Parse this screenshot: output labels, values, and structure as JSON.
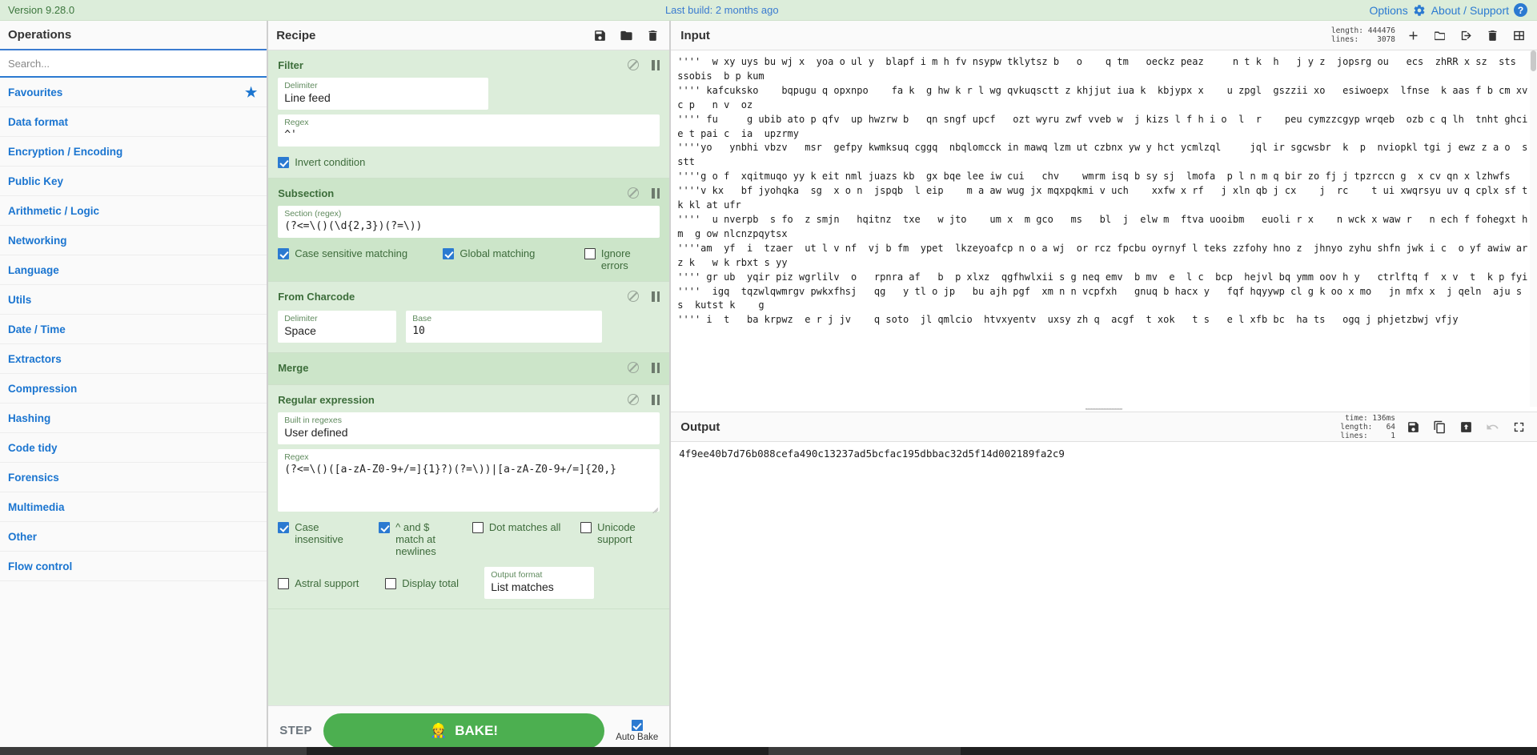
{
  "banner": {
    "version": "Version 9.28.0",
    "last_build": "Last build: 2 months ago",
    "options_label": "Options",
    "about_label": "About / Support"
  },
  "sidebar": {
    "title": "Operations",
    "search_placeholder": "Search...",
    "items": [
      {
        "label": "Favourites",
        "starred": true
      },
      {
        "label": "Data format"
      },
      {
        "label": "Encryption / Encoding"
      },
      {
        "label": "Public Key"
      },
      {
        "label": "Arithmetic / Logic"
      },
      {
        "label": "Networking"
      },
      {
        "label": "Language"
      },
      {
        "label": "Utils"
      },
      {
        "label": "Date / Time"
      },
      {
        "label": "Extractors"
      },
      {
        "label": "Compression"
      },
      {
        "label": "Hashing"
      },
      {
        "label": "Code tidy"
      },
      {
        "label": "Forensics"
      },
      {
        "label": "Multimedia"
      },
      {
        "label": "Other"
      },
      {
        "label": "Flow control"
      }
    ]
  },
  "recipe": {
    "title": "Recipe",
    "icons": [
      "save-icon",
      "folder-icon",
      "trash-icon"
    ],
    "operations": [
      {
        "name": "Filter",
        "fields": [
          {
            "label": "Delimiter",
            "value": "Line feed"
          },
          {
            "label": "Regex",
            "value": "^'"
          }
        ],
        "checkboxes": [
          {
            "label": "Invert condition",
            "checked": true
          }
        ]
      },
      {
        "name": "Subsection",
        "fields": [
          {
            "label": "Section (regex)",
            "value": "(?<=\\()(\\d{2,3})(?=\\))"
          }
        ],
        "checkboxes": [
          {
            "label": "Case sensitive matching",
            "checked": true
          },
          {
            "label": "Global matching",
            "checked": true
          },
          {
            "label": "Ignore errors",
            "checked": false
          }
        ]
      },
      {
        "name": "From Charcode",
        "fields": [
          {
            "label": "Delimiter",
            "value": "Space"
          },
          {
            "label": "Base",
            "value": "10"
          }
        ],
        "checkboxes": []
      },
      {
        "name": "Merge",
        "fields": [],
        "checkboxes": []
      },
      {
        "name": "Regular expression",
        "fields": [
          {
            "label": "Built in regexes",
            "value": "User defined"
          },
          {
            "label": "Regex",
            "value": "(?<=\\()([a-zA-Z0-9+/=]{1}?)(?=\\))|[a-zA-Z0-9+/=]{20,}"
          },
          {
            "label": "Output format",
            "value": "List matches"
          }
        ],
        "checkboxes": [
          {
            "label": "Case insensitive",
            "checked": true
          },
          {
            "label": "^ and $ match at newlines",
            "checked": true
          },
          {
            "label": "Dot matches all",
            "checked": false
          },
          {
            "label": "Unicode support",
            "checked": false
          },
          {
            "label": "Astral support",
            "checked": false
          },
          {
            "label": "Display total",
            "checked": false
          }
        ]
      }
    ],
    "controls": {
      "step_label": "STEP",
      "bake_label": "BAKE!",
      "bake_icon": "chef-emoji",
      "auto_bake_label": "Auto Bake",
      "auto_bake_checked": true,
      "bake_color": "#4caf50"
    }
  },
  "input": {
    "title": "Input",
    "meta_length_label": "length:",
    "meta_length": "444476",
    "meta_lines_label": "lines:",
    "meta_lines": "3078",
    "icons": [
      "plus-icon",
      "folder-open-icon",
      "open-in-icon",
      "trash-icon",
      "tabs-icon"
    ],
    "text": "''''  w xy uys bu wj x  yoa o ul y  blapf i m h fv nsypw tklytsz b   o    q tm   oeckz peaz     n t k  h   j y z  jopsrg ou   ecs  zhRR x sz  sts   ssobis  b p kum\n'''' kafcuksko    bqpugu q opxnpo    fa k  g hw k r l wg qvkuqsctt z khjjut iua k  kbjypx x    u zpgl  gszzii xo   esiwoepx  lfnse  k aas f b cm xvc p   n v  oz\n'''' fu     g ubib ato p qfv  up hwzrw b   qn sngf upcf   ozt wyru zwf vveb w  j kizs l f h i o  l  r    peu cymzzcgyp wrqeb  ozb c q lh  tnht ghci e t pai c  ia  upzrmy\n''''yo   ynbhi vbzv   msr  gefpy kwmksuq cggq  nbqlomcck in mawq lzm ut czbnx yw y hct ycmlzql     jql ir sgcwsbr  k  p  nviopkl tgi j ewz z a o  sstt\n''''g o f  xqitmuqo yy k eit nml juazs kb  gx bqe lee iw cui   chv    wmrm isq b sy sj  lmofa  p l n m q bir zo fj j tpzrccn g  x cv qn x lzhwfs\n''''v kx   bf jyohqka  sg  x o n  jspqb  l eip    m a aw wug jx mqxpqkmi v uch    xxfw x rf   j xln qb j cx    j  rc    t ui xwqrsyu uv q cplx sf tk kl at ufr\n''''  u nverpb  s fo  z smjn   hqitnz  txe   w jto    um x  m gco   ms   bl  j  elw m  ftva uooibm   euoli r x    n wck x waw r   n ech f fohegxt hm  g ow nlcnzpqytsx\n''''am  yf  i  tzaer  ut l v nf  vj b fm  ypet  lkzeyoafcp n o a wj  or rcz fpcbu oyrnyf l teks zzfohy hno z  jhnyo zyhu shfn jwk i c  o yf awiw ar  z k   w k rbxt s yy\n'''' gr ub  yqir piz wgrlilv  o   rpnra af   b  p xlxz  qgfhwlxii s g neq emv  b mv  e  l c  bcp  hejvl bq ymm oov h y   ctrlftq f  x v  t  k p fyi\n''''  igq  tqzwlqwmrgv pwkxfhsj   qg   y tl o jp   bu ajh pgf  xm n n vcpfxh   gnuq b hacx y   fqf hqyywp cl g k oo x mo   jn mfx x  j qeln  aju s s  kutst k    g\n'''' i  t   ba krpwz  e r j jv    q soto  jl qmlcio  htvxyentv  uxsy zh q  acgf  t xok   t s   e l xfb bc  ha ts   ogq j phjetzbwj vfjy"
  },
  "output": {
    "title": "Output",
    "meta_time_label": "time:",
    "meta_time": "136ms",
    "meta_length_label": "length:",
    "meta_length": "64",
    "meta_lines_label": "lines:",
    "meta_lines": "1",
    "icons": [
      "save-icon",
      "copy-icon",
      "replace-input-icon",
      "undo-icon",
      "maximize-icon"
    ],
    "text": "4f9ee40b7d76b088cefa490c13237ad5bcfac195dbbac32d5f14d002189fa2c9"
  }
}
